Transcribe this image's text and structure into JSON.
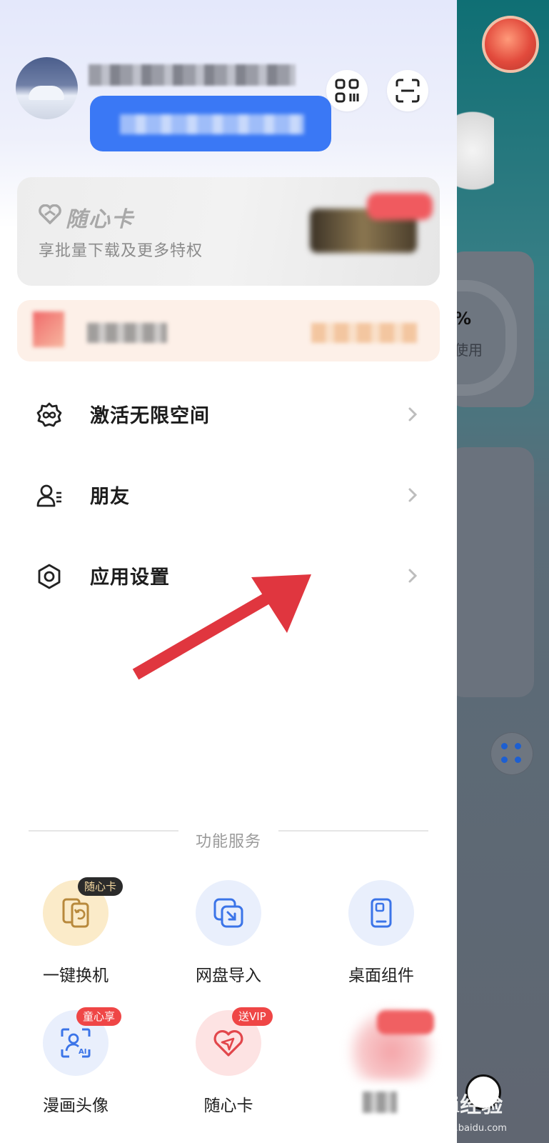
{
  "drawer": {
    "card": {
      "title": "随心卡",
      "subtitle": "享批量下载及更多特权"
    },
    "menu": [
      {
        "label": "激活无限空间",
        "icon": "infinity-flower-icon"
      },
      {
        "label": "朋友",
        "icon": "friends-icon"
      },
      {
        "label": "应用设置",
        "icon": "hexagon-settings-icon"
      }
    ],
    "services_title": "功能服务",
    "services": [
      {
        "label": "一键换机",
        "badge": "随心卡",
        "icon": "phone-switch-icon"
      },
      {
        "label": "网盘导入",
        "badge": "",
        "icon": "import-icon"
      },
      {
        "label": "桌面组件",
        "badge": "",
        "icon": "phone-widget-icon"
      },
      {
        "label": "漫画头像",
        "badge": "童心享",
        "icon": "ai-avatar-icon"
      },
      {
        "label": "随心卡",
        "badge": "送VIP",
        "icon": "heart-card-icon"
      }
    ]
  },
  "background": {
    "usage_percent_fragment": "%",
    "usage_text_fragment": "使用"
  },
  "watermark": {
    "brand": "Bai经验",
    "url": "jingyan.baidu.com"
  },
  "colors": {
    "accent_blue": "#3a78f5",
    "badge_red": "#ef4646",
    "annotation_arrow": "#e0363f"
  }
}
